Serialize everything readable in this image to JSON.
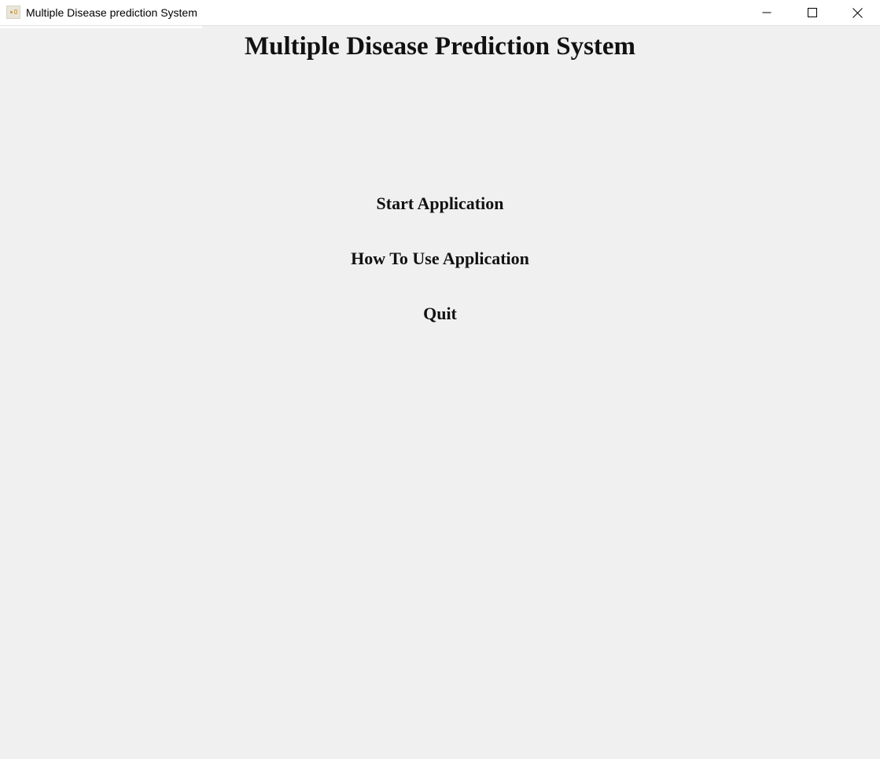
{
  "window": {
    "title": "Multiple Disease prediction System",
    "app_icon": "app-icon",
    "controls": {
      "minimize_icon": "minimize-icon",
      "maximize_icon": "maximize-icon",
      "close_icon": "close-icon"
    }
  },
  "main": {
    "heading": "Multiple Disease Prediction System",
    "buttons": [
      {
        "label": "Start Application"
      },
      {
        "label": "How To Use Application"
      },
      {
        "label": "Quit"
      }
    ]
  },
  "colors": {
    "background": "#f0f0f0",
    "titlebar": "#ffffff",
    "text": "#111111"
  }
}
